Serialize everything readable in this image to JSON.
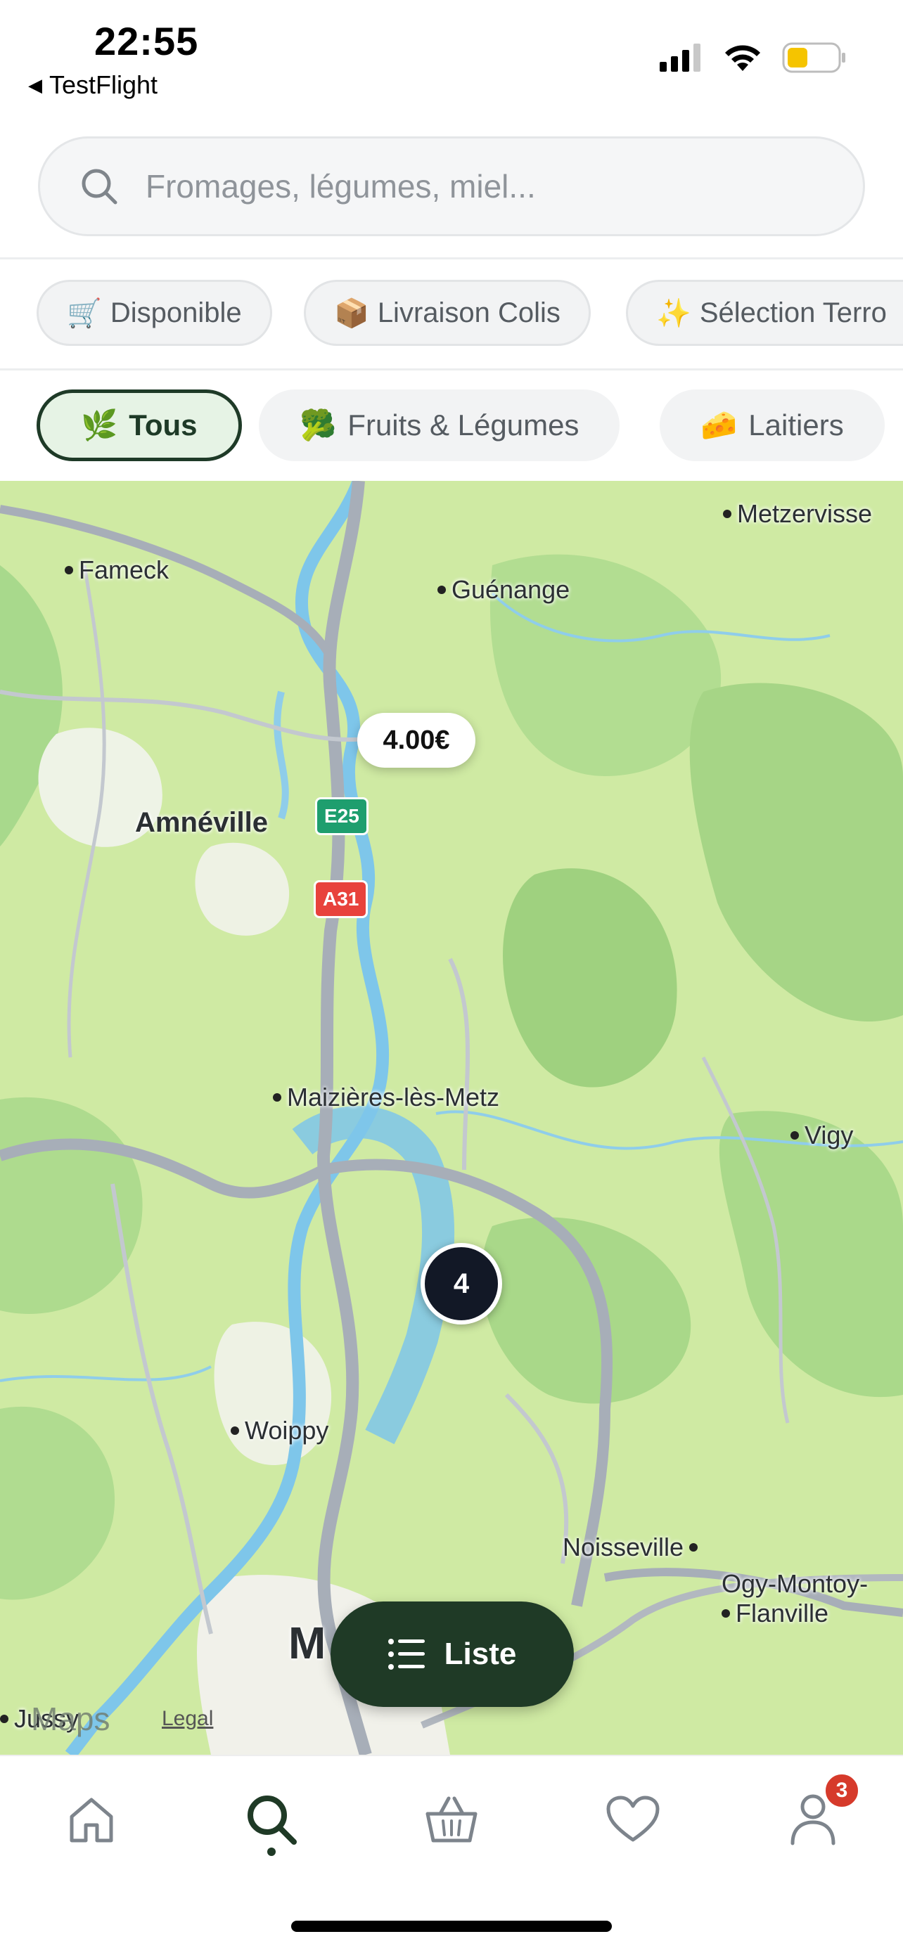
{
  "status_bar": {
    "time": "22:55",
    "back_app": "TestFlight"
  },
  "search": {
    "placeholder": "Fromages, légumes, miel..."
  },
  "filters": [
    {
      "emoji": "🛒",
      "label": "Disponible"
    },
    {
      "emoji": "📦",
      "label": "Livraison Colis"
    },
    {
      "emoji": "✨",
      "label": "Sélection Terro"
    }
  ],
  "categories": [
    {
      "emoji": "🌿",
      "label": "Tous",
      "active": true
    },
    {
      "emoji": "🥦",
      "label": "Fruits & Légumes",
      "active": false
    },
    {
      "emoji": "🧀",
      "label": "Laitiers",
      "active": false
    }
  ],
  "map": {
    "places": {
      "metzervisse": "Metzervisse",
      "fameck": "Fameck",
      "guenange": "Guénange",
      "amneville": "Amnéville",
      "maizieres": "Maizières-lès-Metz",
      "vigy": "Vigy",
      "woippy": "Woippy",
      "noisseville": "Noisseville",
      "ogy": "Ogy-Montoy-",
      "flanville": "Flanville",
      "jussy": "Jussy",
      "metz_partial": "M"
    },
    "road_shields": {
      "e25": "E25",
      "a31": "A31"
    },
    "price_pin": "4.00€",
    "cluster_count": "4",
    "attribution": "Maps",
    "legal": "Legal"
  },
  "list_button": "Liste",
  "tab_bar": {
    "items": [
      {
        "icon": "home-icon"
      },
      {
        "icon": "search-icon",
        "active": true
      },
      {
        "icon": "basket-icon"
      },
      {
        "icon": "heart-icon"
      },
      {
        "icon": "profile-icon"
      }
    ],
    "profile_badge": "3"
  },
  "colors": {
    "accent": "#1f3a26",
    "active_chip_bg": "#e6f3e5",
    "badge": "#d63a2b"
  }
}
